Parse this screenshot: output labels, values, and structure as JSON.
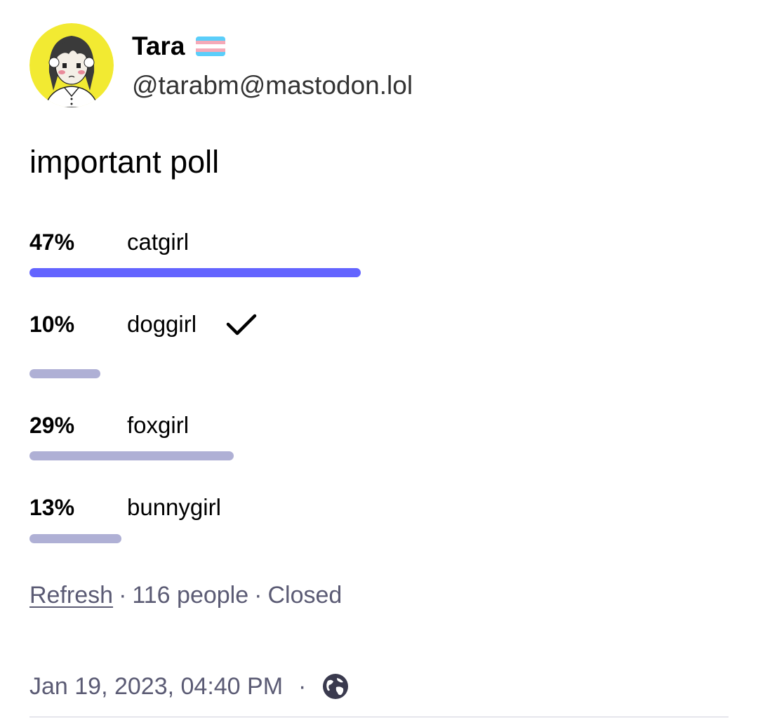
{
  "author": {
    "display_name": "Tara",
    "handle": "@tarabm@mastodon.lol",
    "avatar_icon": "avatar-illustration",
    "flag_icon": "transgender-flag"
  },
  "post": {
    "text": "important poll"
  },
  "poll": {
    "options": [
      {
        "percent_label": "47%",
        "label": "catgirl",
        "percent": 47,
        "leading": true,
        "voted": false
      },
      {
        "percent_label": "10%",
        "label": "doggirl",
        "percent": 10,
        "leading": false,
        "voted": true
      },
      {
        "percent_label": "29%",
        "label": "foxgirl",
        "percent": 29,
        "leading": false,
        "voted": false
      },
      {
        "percent_label": "13%",
        "label": "bunnygirl",
        "percent": 13,
        "leading": false,
        "voted": false
      }
    ],
    "refresh_label": "Refresh",
    "separator": "·",
    "voters": "116 people",
    "status": "Closed"
  },
  "meta": {
    "timestamp": "Jan 19, 2023, 04:40 PM",
    "separator": "·",
    "visibility_icon": "globe-icon"
  },
  "colors": {
    "leading_bar": "#6364ff",
    "other_bar": "#afb0d5",
    "avatar_bg": "#f2ea32",
    "flag_blue": "#5bcefa",
    "flag_pink": "#f5a9b8",
    "flag_white": "#ffffff"
  }
}
